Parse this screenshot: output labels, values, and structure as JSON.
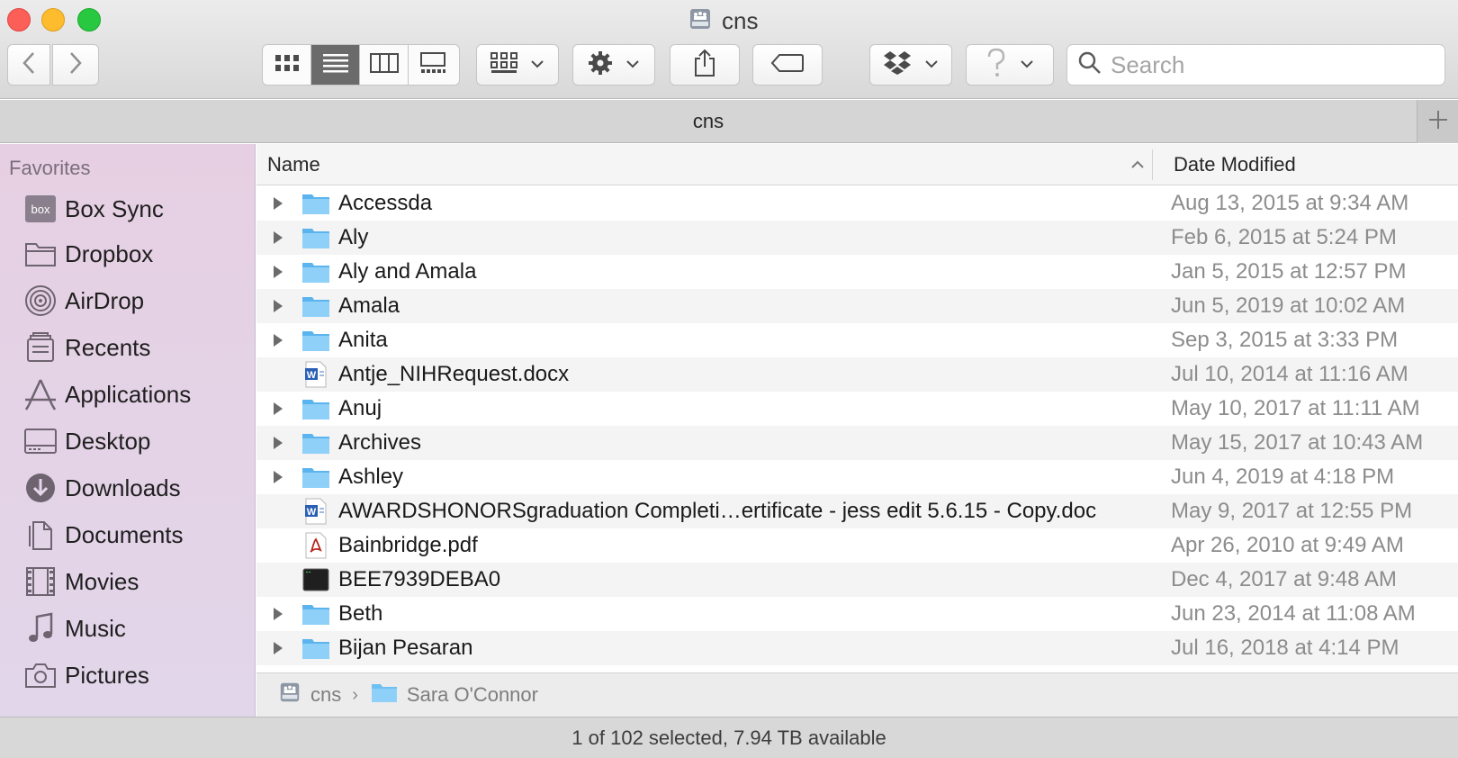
{
  "window": {
    "title": "cns"
  },
  "toolbar": {
    "search_placeholder": "Search"
  },
  "tabbar": {
    "label": "cns"
  },
  "sidebar": {
    "heading": "Favorites",
    "items": [
      {
        "label": "Box Sync",
        "icon": "box-sync-icon"
      },
      {
        "label": "Dropbox",
        "icon": "folder-icon"
      },
      {
        "label": "AirDrop",
        "icon": "airdrop-icon"
      },
      {
        "label": "Recents",
        "icon": "recents-icon"
      },
      {
        "label": "Applications",
        "icon": "applications-icon"
      },
      {
        "label": "Desktop",
        "icon": "desktop-icon"
      },
      {
        "label": "Downloads",
        "icon": "downloads-icon"
      },
      {
        "label": "Documents",
        "icon": "documents-icon"
      },
      {
        "label": "Movies",
        "icon": "movies-icon"
      },
      {
        "label": "Music",
        "icon": "music-icon"
      },
      {
        "label": "Pictures",
        "icon": "pictures-icon"
      }
    ]
  },
  "list": {
    "columns": {
      "name": "Name",
      "date": "Date Modified"
    },
    "rows": [
      {
        "name": "Accessda",
        "date": "Aug 13, 2015 at 9:34 AM",
        "type": "folder"
      },
      {
        "name": "Aly",
        "date": "Feb 6, 2015 at 5:24 PM",
        "type": "folder"
      },
      {
        "name": "Aly and Amala",
        "date": "Jan 5, 2015 at 12:57 PM",
        "type": "folder"
      },
      {
        "name": "Amala",
        "date": "Jun 5, 2019 at 10:02 AM",
        "type": "folder"
      },
      {
        "name": "Anita",
        "date": "Sep 3, 2015 at 3:33 PM",
        "type": "folder"
      },
      {
        "name": "Antje_NIHRequest.docx",
        "date": "Jul 10, 2014 at 11:16 AM",
        "type": "word"
      },
      {
        "name": "Anuj",
        "date": "May 10, 2017 at 11:11 AM",
        "type": "folder"
      },
      {
        "name": "Archives",
        "date": "May 15, 2017 at 10:43 AM",
        "type": "folder"
      },
      {
        "name": "Ashley",
        "date": "Jun 4, 2019 at 4:18 PM",
        "type": "folder"
      },
      {
        "name": "AWARDSHONORSgraduation Completi…ertificate - jess edit 5.6.15 - Copy.doc",
        "date": "May 9, 2017 at 12:55 PM",
        "type": "word"
      },
      {
        "name": "Bainbridge.pdf",
        "date": "Apr 26, 2010 at 9:49 AM",
        "type": "pdf"
      },
      {
        "name": "BEE7939DEBA0",
        "date": "Dec 4, 2017 at 9:48 AM",
        "type": "exec"
      },
      {
        "name": "Beth",
        "date": "Jun 23, 2014 at 11:08 AM",
        "type": "folder"
      },
      {
        "name": "Bijan Pesaran",
        "date": "Jul 16, 2018 at 4:14 PM",
        "type": "folder"
      }
    ]
  },
  "pathbar": {
    "segments": [
      "cns",
      "Sara O'Connor"
    ]
  },
  "status": {
    "text": "1 of 102 selected, 7.94 TB available"
  },
  "colors": {
    "sidebar": "#e4d2e6",
    "folder": "#6cc0f4",
    "active_segment": "#6b6b6b"
  }
}
